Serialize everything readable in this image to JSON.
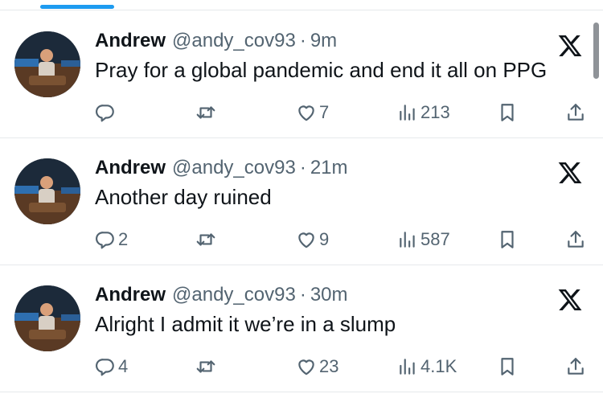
{
  "tweets": [
    {
      "name": "Andrew",
      "handle": "@andy_cov93",
      "separator": "·",
      "time": "9m",
      "text": "Pray for a global pandemic and end it all on PPG",
      "replies": "",
      "retweets": "",
      "likes": "7",
      "views": "213"
    },
    {
      "name": "Andrew",
      "handle": "@andy_cov93",
      "separator": "·",
      "time": "21m",
      "text": "Another day ruined",
      "replies": "2",
      "retweets": "",
      "likes": "9",
      "views": "587"
    },
    {
      "name": "Andrew",
      "handle": "@andy_cov93",
      "separator": "·",
      "time": "30m",
      "text": "Alright I admit it we’re in a slump",
      "replies": "4",
      "retweets": "",
      "likes": "23",
      "views": "4.1K"
    }
  ],
  "icons": {
    "brand": "x-logo-icon",
    "reply": "reply-icon",
    "retweet": "retweet-icon",
    "like": "heart-icon",
    "views": "views-icon",
    "bookmark": "bookmark-icon",
    "share": "share-icon"
  },
  "colors": {
    "text": "#0f1419",
    "muted": "#536471",
    "accent": "#1d9bf0",
    "divider": "#e6e9ec"
  }
}
